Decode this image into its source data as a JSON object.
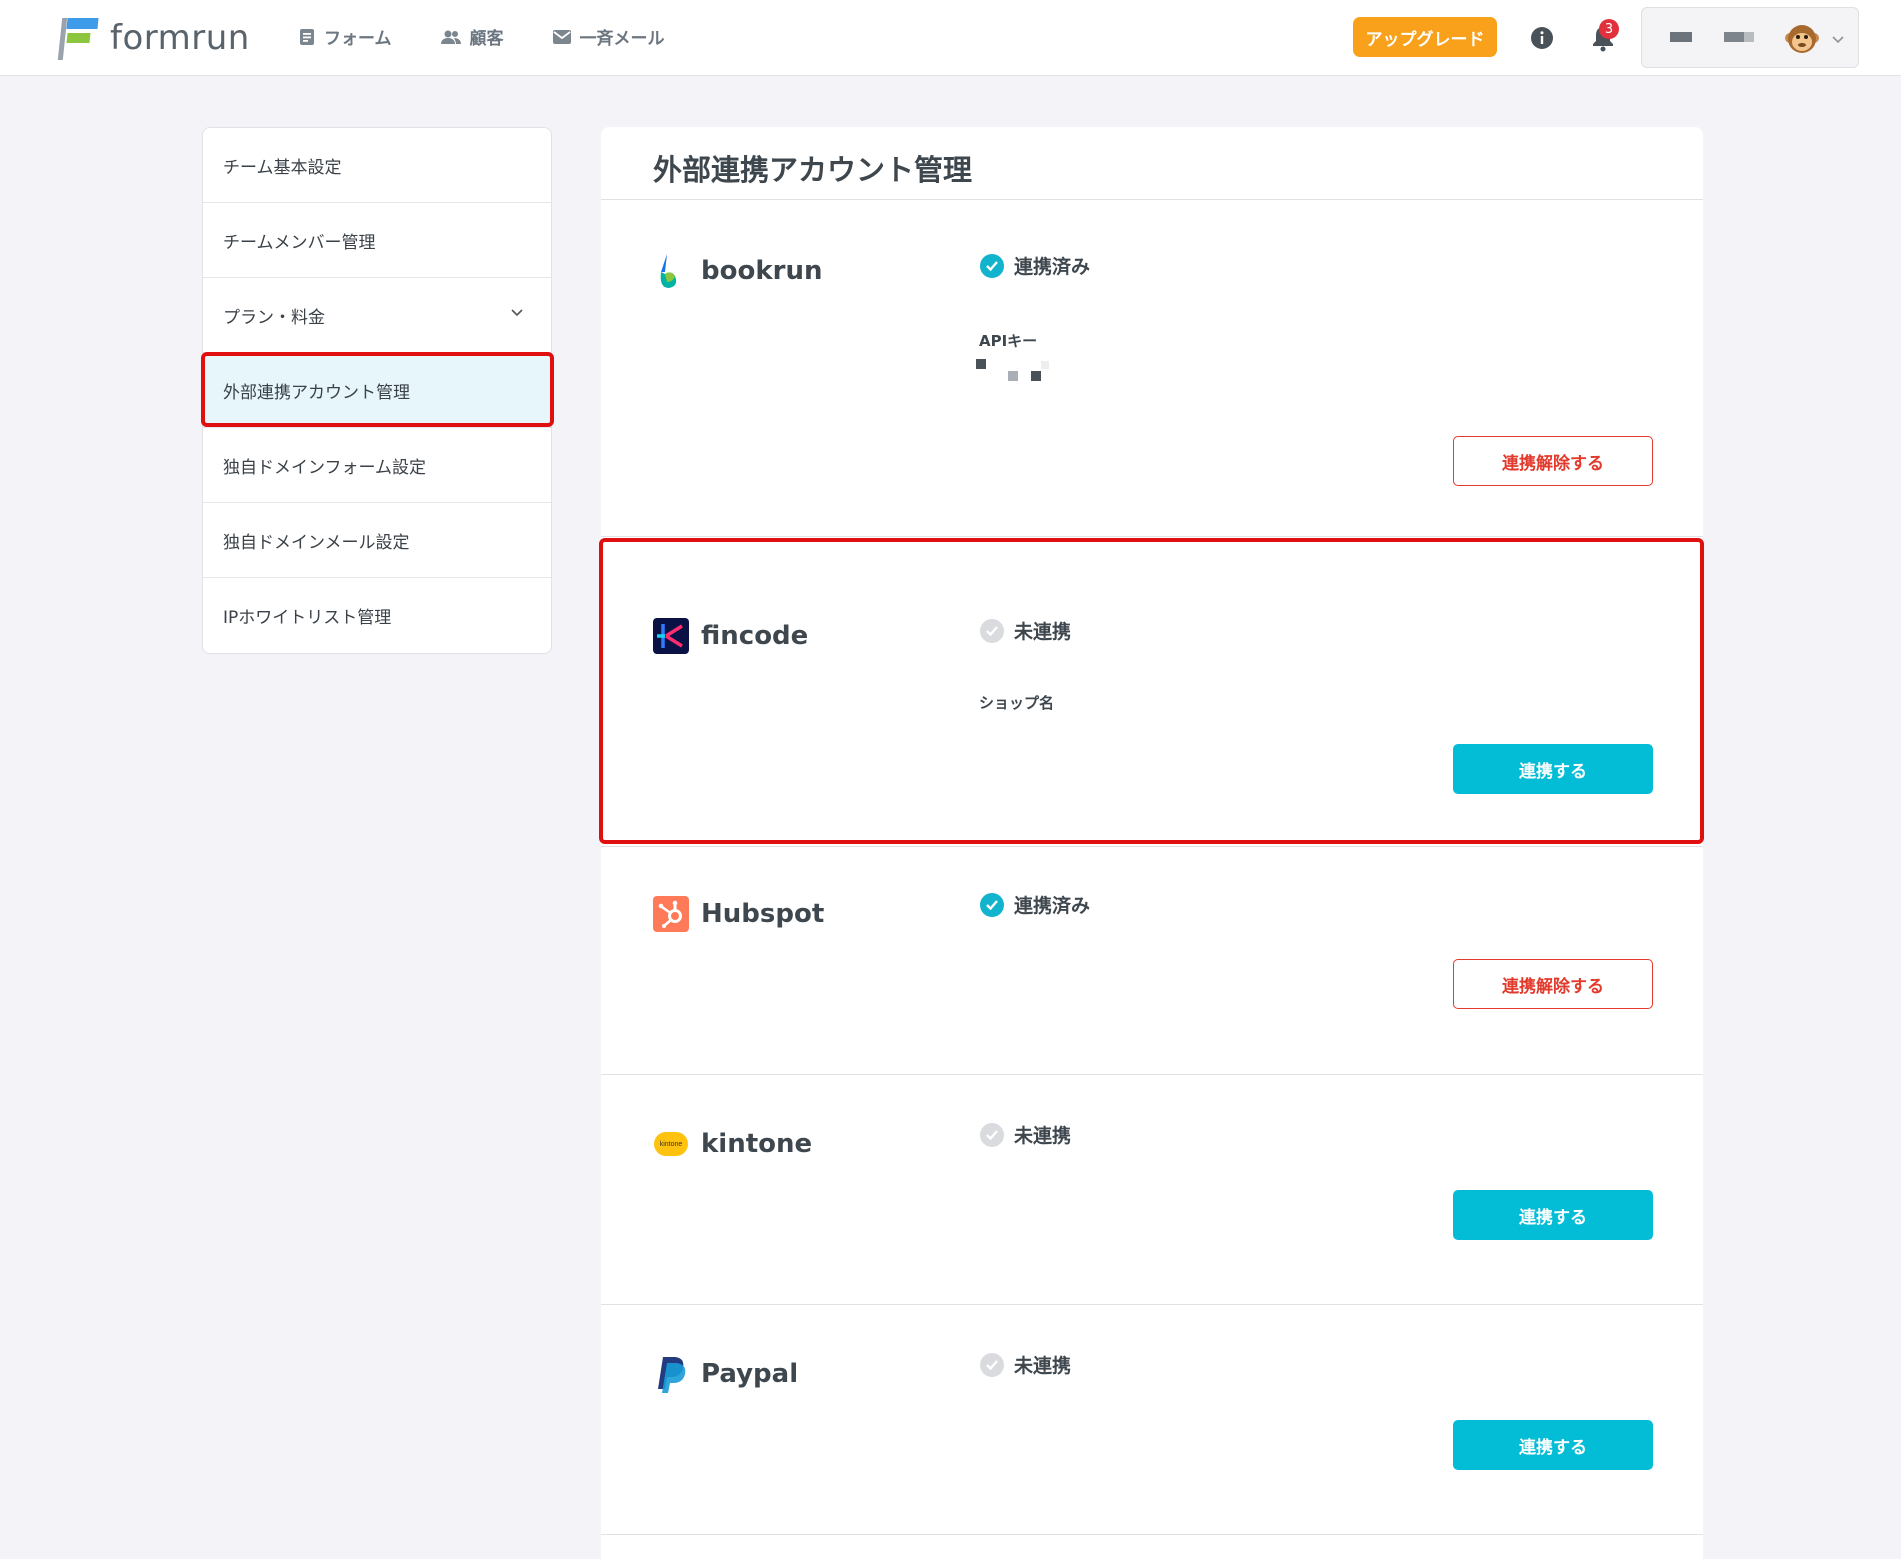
{
  "header": {
    "logo_text": "formrun",
    "nav": [
      {
        "label": "フォーム",
        "icon": "form-icon"
      },
      {
        "label": "顧客",
        "icon": "people-icon"
      },
      {
        "label": "一斉メール",
        "icon": "mail-icon"
      }
    ],
    "upgrade_label": "アップグレード",
    "notification_count": "3"
  },
  "sidebar": {
    "items": [
      {
        "label": "チーム基本設定"
      },
      {
        "label": "チームメンバー管理"
      },
      {
        "label": "プラン・料金"
      },
      {
        "label": "外部連携アカウント管理"
      },
      {
        "label": "独自ドメインフォーム設定"
      },
      {
        "label": "独自ドメインメール設定"
      },
      {
        "label": "IPホワイトリスト管理"
      }
    ]
  },
  "main": {
    "title": "外部連携アカウント管理",
    "integrations": [
      {
        "name": "bookrun",
        "status": "連携済み",
        "field_label": "APIキー",
        "button": "連携解除する"
      },
      {
        "name": "fincode",
        "status": "未連携",
        "field_label": "ショップ名",
        "button": "連携する"
      },
      {
        "name": "Hubspot",
        "status": "連携済み",
        "button": "連携解除する"
      },
      {
        "name": "kintone",
        "status": "未連携",
        "logo_text": "kintone",
        "button": "連携する"
      },
      {
        "name": "Paypal",
        "status": "未連携",
        "button": "連携する"
      }
    ]
  },
  "colors": {
    "accent": "#03bcd6",
    "upgrade": "#f9a11b",
    "danger": "#e23a2c",
    "highlight": "#e01010"
  }
}
